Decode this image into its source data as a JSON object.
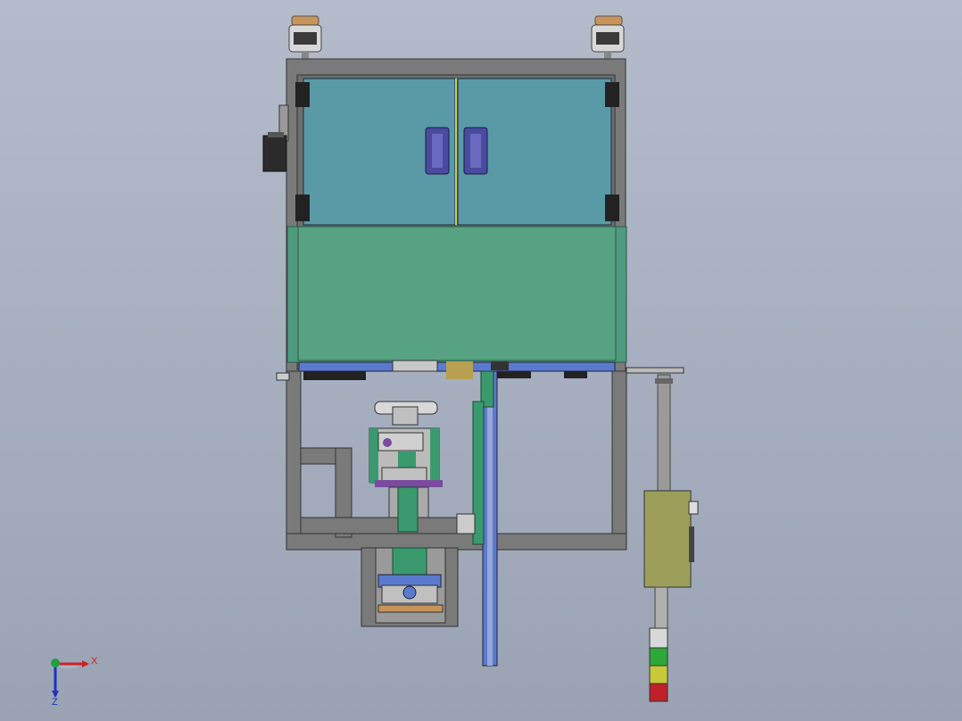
{
  "viewport": {
    "background_top": "#b4bccb",
    "background_bottom": "#9aa3b4"
  },
  "colors": {
    "frame": "#7a7a7a",
    "frame_edge": "#3a3a3a",
    "glass_top": "#5a9aa6",
    "glass_lower": "#56a282",
    "handle": "#4a4a9e",
    "hinge": "#222222",
    "mechanism_green": "#3a9a6e",
    "mechanism_purple": "#7a4aa0",
    "motor": "#2b2b2b",
    "control_box": "#9c9f5a",
    "stack_green": "#2fa83a",
    "stack_yellow": "#c8c83a",
    "stack_red": "#c0202a",
    "axis_x": "#d0202a",
    "axis_y": "#20a040",
    "axis_z": "#2030c0"
  },
  "icons": {
    "foot_left": "leveling-foot-icon",
    "foot_right": "leveling-foot-icon",
    "triad": "coordinate-triad-icon"
  },
  "triad": {
    "x_label": "X",
    "z_label": "Z"
  }
}
